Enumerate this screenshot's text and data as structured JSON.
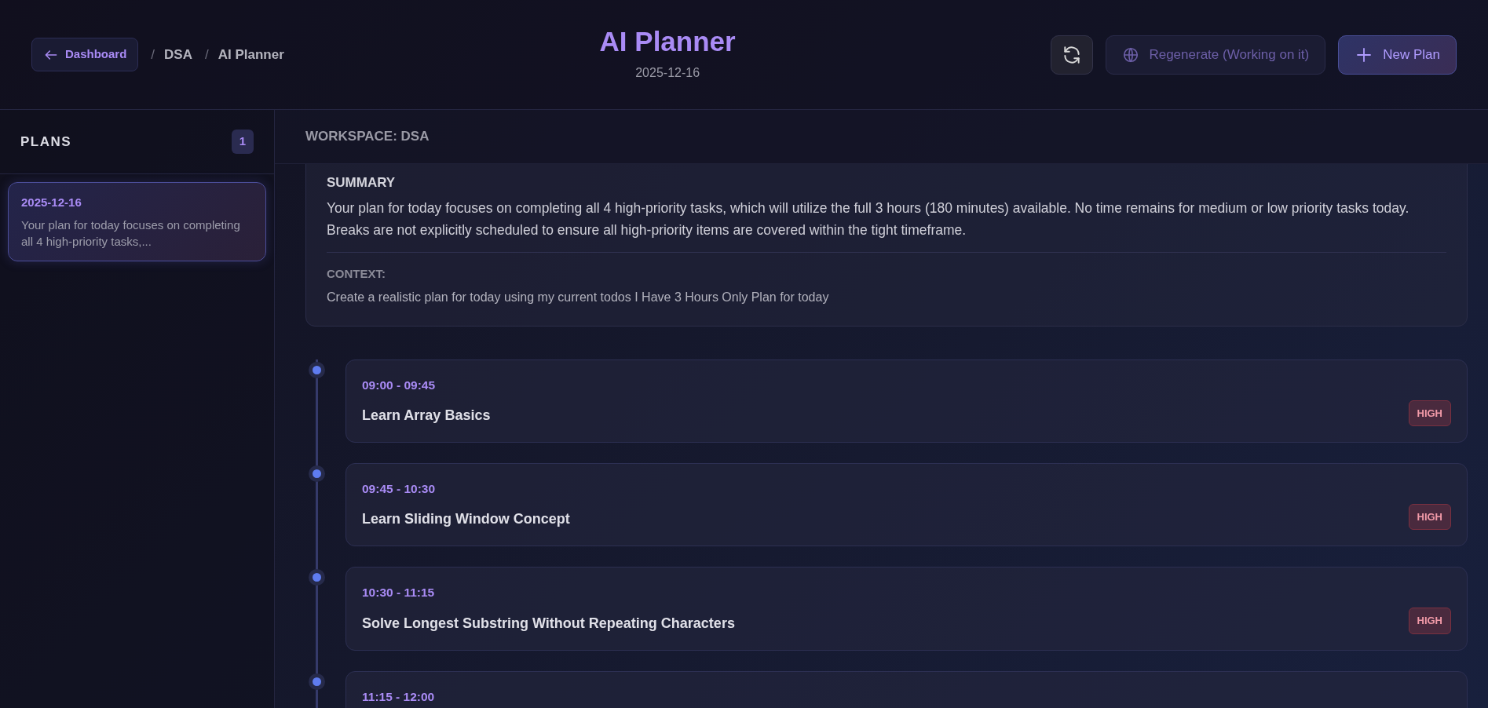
{
  "header": {
    "back_button": "Dashboard",
    "breadcrumbs": [
      {
        "separator": "/",
        "label": "DSA"
      },
      {
        "separator": "/",
        "label": "AI Planner"
      }
    ],
    "title": "AI Planner",
    "date": "2025-12-16",
    "actions": [
      {
        "kind": "refresh"
      },
      {
        "kind": "regenerate",
        "label": "Regenerate (Working on it)",
        "disabled": true
      },
      {
        "kind": "new",
        "label": "New Plan"
      }
    ]
  },
  "sidebar": {
    "title": "PLANS",
    "count": "1",
    "plans": [
      {
        "date": "2025-12-16",
        "preview": "Your plan for today focuses on completing all 4 high-priority tasks,...",
        "selected": true
      }
    ]
  },
  "workspace": "WORKSPACE: DSA",
  "summary": {
    "heading": "SUMMARY",
    "text": "Your plan for today focuses on completing all 4 high-priority tasks, which will utilize the full 3 hours (180 minutes) available. No time remains for medium or low priority tasks today. Breaks are not explicitly scheduled to ensure all high-priority items are covered within the tight timeframe.",
    "context_label": "CONTEXT:",
    "context": "Create a realistic plan for today using my current todos I Have 3 Hours Only Plan for today"
  },
  "timeline": [
    {
      "time": "09:00 - 09:45",
      "title": "Learn Array Basics",
      "priority": "HIGH"
    },
    {
      "time": "09:45 - 10:30",
      "title": "Learn Sliding Window Concept",
      "priority": "HIGH"
    },
    {
      "time": "10:30 - 11:15",
      "title": "Solve Longest Substring Without Repeating Characters",
      "priority": "HIGH"
    },
    {
      "time": "11:15 - 12:00"
    }
  ]
}
